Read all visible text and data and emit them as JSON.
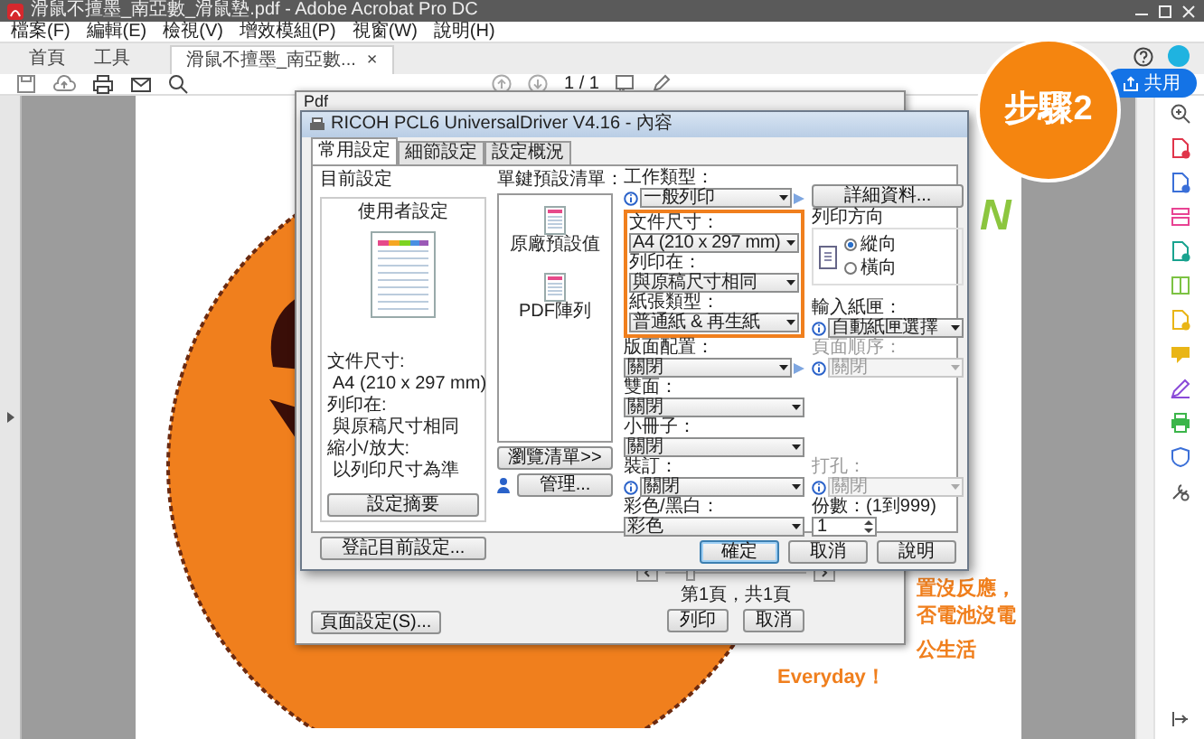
{
  "window": {
    "title": "滑鼠不擅墨_南亞數_滑鼠墊.pdf - Adobe Acrobat Pro DC"
  },
  "menu": [
    "檔案(F)",
    "編輯(E)",
    "檢視(V)",
    "增效模組(P)",
    "視窗(W)",
    "說明(H)"
  ],
  "tabs": [
    {
      "label": "首頁",
      "selected": false
    },
    {
      "label": "工具",
      "selected": false
    },
    {
      "label": "滑鼠不擅墨_南亞數...",
      "selected": true,
      "close": "×"
    }
  ],
  "share_button": "共用",
  "toolbar": {
    "page_indicator": "1 / 1"
  },
  "step_badge": "步驟2",
  "document": {
    "logo_fragment": "N",
    "lines": [
      "置沒反應，",
      "否電池沒電",
      "公生活"
    ],
    "slogan": "Everyday！"
  },
  "print_dialog": {
    "title": "Pdf",
    "page_info": "第1頁，共1頁",
    "buttons": [
      "列印",
      "取消"
    ],
    "page_setup_button": "頁面設定(S)..."
  },
  "properties_dialog": {
    "title": "RICOH PCL6 UniversalDriver V4.16 - 內容",
    "tabs": [
      {
        "label": "常用設定",
        "selected": true
      },
      {
        "label": "細節設定",
        "selected": false
      },
      {
        "label": "設定概況",
        "selected": false
      }
    ],
    "current_settings": {
      "label": "目前設定",
      "name": "使用者設定",
      "summary": [
        "文件尺寸:",
        "A4 (210 x 297 mm)",
        "列印在:",
        "與原稿尺寸相同",
        "縮小/放大:",
        "以列印尺寸為準"
      ],
      "summary_button": "設定摘要",
      "register_button": "登記目前設定..."
    },
    "presets": {
      "label": "單鍵預設清單：",
      "items": [
        "原廠預設值",
        "PDF陣列"
      ],
      "browse_button": "瀏覽清單>>",
      "manage_button": "管理..."
    },
    "job_type": {
      "label": "工作類型：",
      "value": "一般列印",
      "info": true,
      "arrow": true
    },
    "details_button": "詳細資料...",
    "paper_group": [
      {
        "label": "文件尺寸：",
        "value": "A4 (210 x 297 mm)"
      },
      {
        "label": "列印在：",
        "value": "與原稿尺寸相同"
      },
      {
        "label": "紙張類型：",
        "value": "普通紙 & 再生紙"
      }
    ],
    "orientation": {
      "label": "列印方向",
      "options": [
        {
          "label": "縱向",
          "selected": true
        },
        {
          "label": "橫向",
          "selected": false
        }
      ]
    },
    "input_tray": {
      "label": "輸入紙匣：",
      "value": "自動紙匣選擇",
      "info": true
    },
    "layout": {
      "label": "版面配置：",
      "value": "關閉",
      "arrow": true
    },
    "page_order": {
      "label": "頁面順序：",
      "value": "關閉",
      "disabled": true,
      "info": true
    },
    "duplex": {
      "label": "雙面：",
      "value": "關閉"
    },
    "booklet": {
      "label": "小冊子：",
      "value": "關閉"
    },
    "staple": {
      "label": "裝訂：",
      "value": "關閉",
      "info": true
    },
    "punch": {
      "label": "打孔：",
      "value": "關閉",
      "disabled": true,
      "info": true
    },
    "color_mode": {
      "label": "彩色/黑白：",
      "value": "彩色"
    },
    "copies": {
      "label": "份數：(1到999)",
      "value": "1"
    },
    "buttons": [
      {
        "label": "確定",
        "default": true
      },
      {
        "label": "取消",
        "default": false
      },
      {
        "label": "說明",
        "default": false
      }
    ]
  }
}
